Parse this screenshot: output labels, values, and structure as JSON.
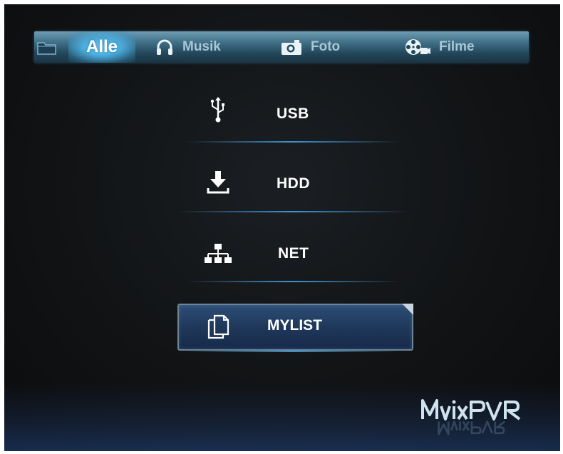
{
  "tabs": [
    {
      "label": "Alle",
      "icon": "folder-icon",
      "active": true
    },
    {
      "label": "Musik",
      "icon": "headphones-icon",
      "active": false
    },
    {
      "label": "Foto",
      "icon": "camera-icon",
      "active": false
    },
    {
      "label": "Filme",
      "icon": "film-reel-icon",
      "active": false
    }
  ],
  "menu": {
    "items": [
      {
        "label": "USB",
        "icon": "usb-icon"
      },
      {
        "label": "HDD",
        "icon": "download-icon"
      },
      {
        "label": "NET",
        "icon": "network-icon"
      },
      {
        "label": "MYLIST",
        "icon": "documents-icon",
        "selected": true
      }
    ]
  },
  "brand": {
    "logo": "MVIXPVR"
  },
  "colors": {
    "accent": "#4fb4e4",
    "tabbar": "#3f7088",
    "selected_bg": "#203a5c",
    "background": "#111315"
  }
}
